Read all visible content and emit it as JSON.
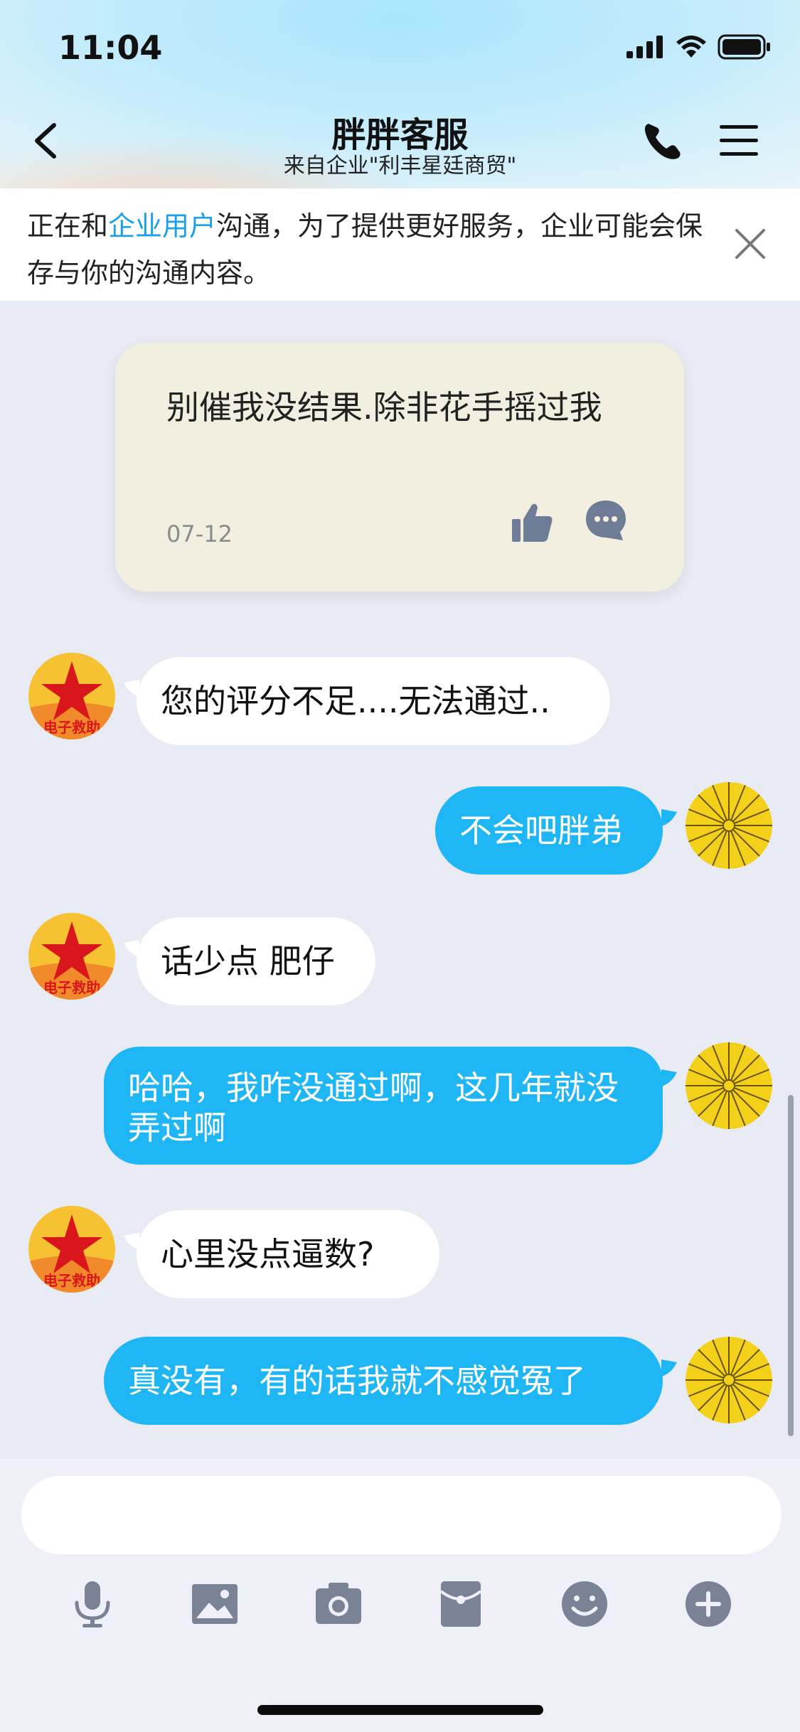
{
  "status_bar": {
    "time": "11:04"
  },
  "header": {
    "title": "胖胖客服",
    "subtitle": "来自企业\"利丰星廷商贸\""
  },
  "notice": {
    "prefix": "正在和",
    "link": "企业用户",
    "suffix": "沟通，为了提供更好服务，企业可能会保存与你的沟通内容。"
  },
  "card": {
    "text": "别催我没结果.除非花手摇过我",
    "date": "07-12"
  },
  "messages": [
    {
      "side": "in",
      "text": "您的评分不足....无法通过.."
    },
    {
      "side": "out",
      "text": "不会吧胖弟"
    },
    {
      "side": "in",
      "text": "话少点 肥仔"
    },
    {
      "side": "out",
      "text": "哈哈，我咋没通过啊，这几年就没弄过啊"
    },
    {
      "side": "in",
      "text": "心里没点逼数?"
    },
    {
      "side": "out",
      "text": "真没有，有的话我就不感觉冤了"
    }
  ],
  "avatar_in": {
    "badge_text": "电子救助"
  },
  "input": {
    "placeholder": ""
  },
  "toolbar": [
    "microphone-icon",
    "image-icon",
    "camera-icon",
    "red-packet-icon",
    "emoji-icon",
    "plus-icon"
  ],
  "colors": {
    "accent": "#1eb6f4",
    "link": "#1aa0e6",
    "card_bg": "#f2efe0",
    "chat_bg": "#e9ebf4"
  }
}
